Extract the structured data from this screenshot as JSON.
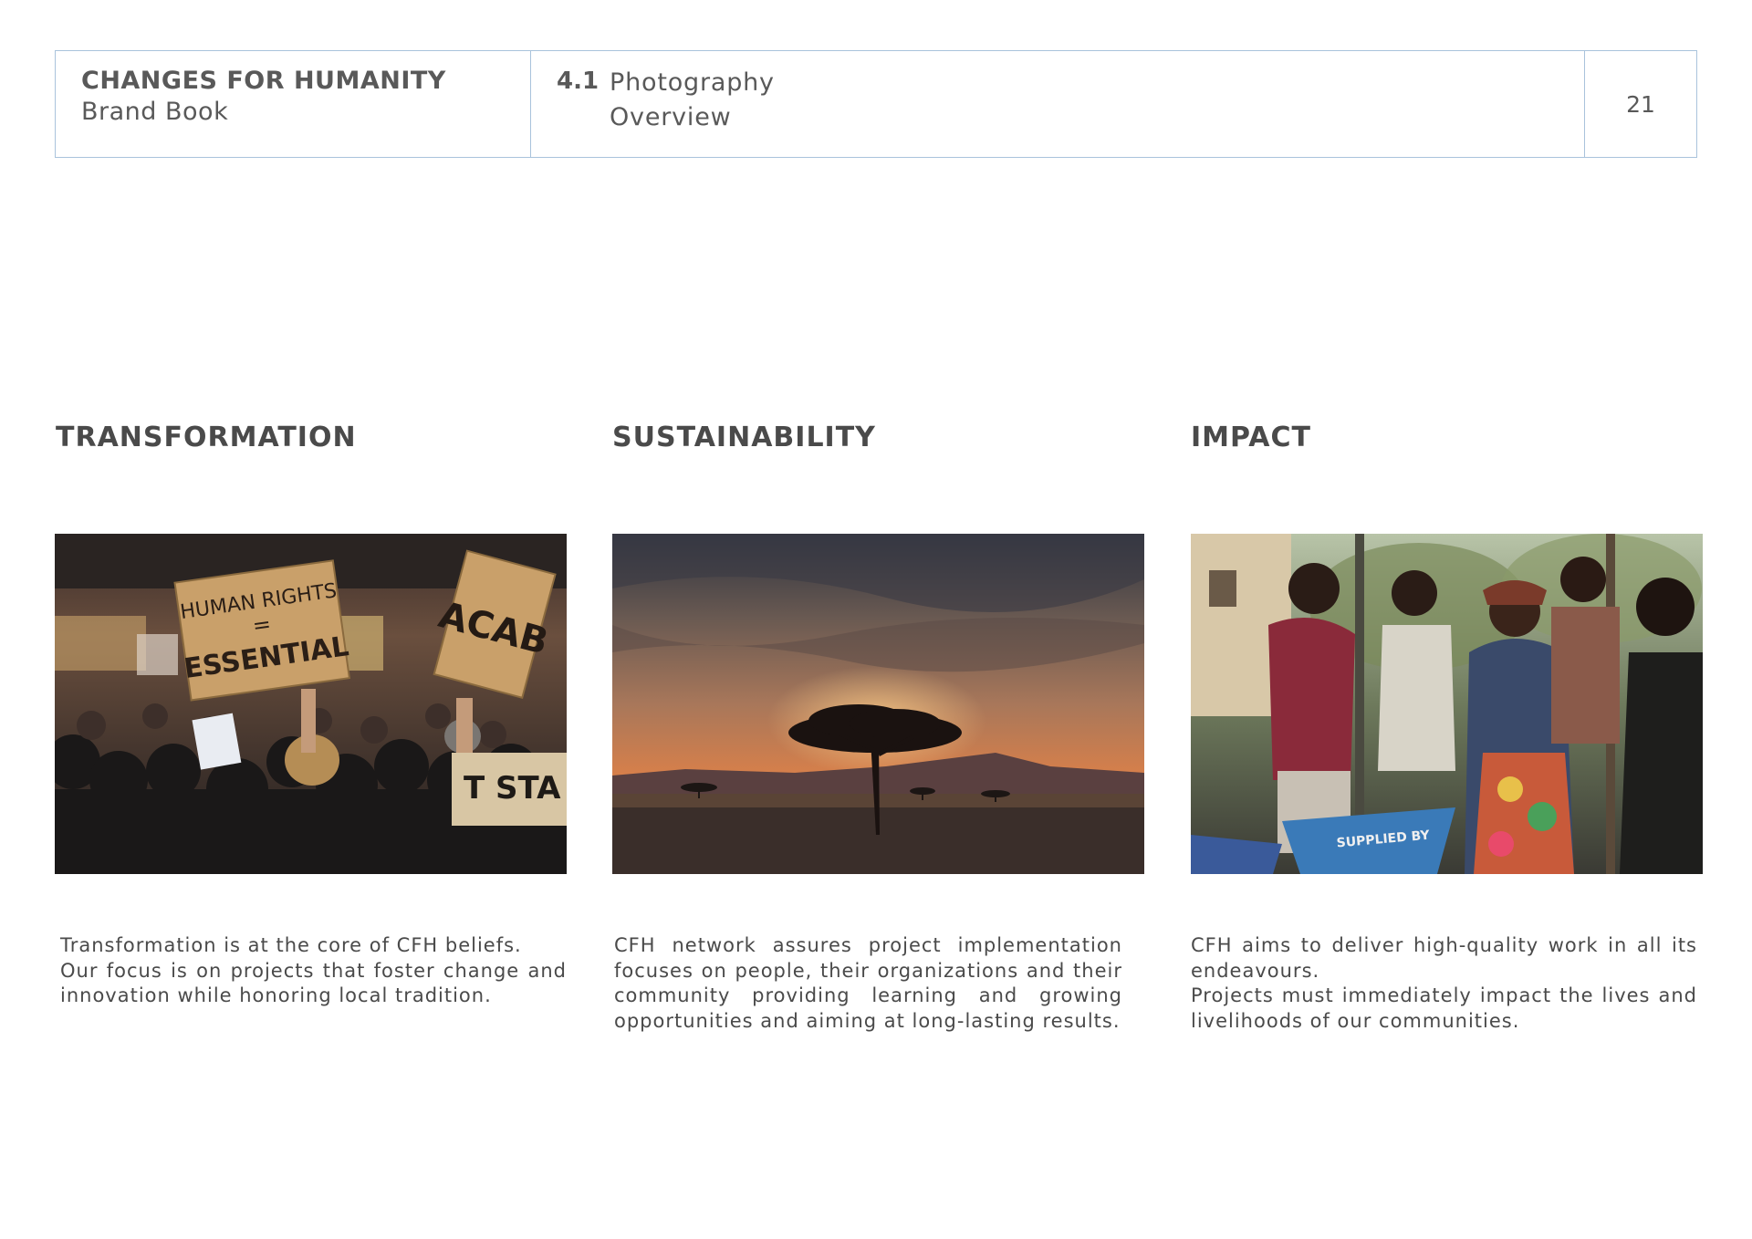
{
  "header": {
    "brand_title": "CHANGES FOR HUMANITY",
    "brand_subtitle": "Brand Book",
    "section_number": "4.1",
    "section_title": "Photography",
    "section_subtitle": "Overview",
    "page_number": "21"
  },
  "columns": [
    {
      "title": "TRANSFORMATION",
      "photo_icon": "protest-crowd-photo",
      "sign_1": [
        "HUMAN RIGHTS",
        "=",
        "ESSENTIAL"
      ],
      "sign_2": "ACAB",
      "sign_3": "T STA",
      "paragraphs": [
        "Transformation is at the core of CFH beliefs.",
        "Our focus is on projects that foster change and innovation while honoring local tradition."
      ]
    },
    {
      "title": "SUSTAINABILITY",
      "photo_icon": "savanna-sunset-tree-photo",
      "paragraphs": [
        "CFH network assures project implementation focuses on people, their organizations and their community providing learning and growing opportunities and aiming at long-lasting results."
      ]
    },
    {
      "title": "IMPACT",
      "photo_icon": "community-work-photo",
      "wheelbarrow_text": "SUPPLIED BY",
      "paragraphs": [
        "CFH aims to deliver high-quality work in all its endeavours.",
        "Projects must immediately impact the lives and livelihoods of our communities."
      ]
    }
  ],
  "colors": {
    "header_border": "#a9c3dc",
    "text": "#4a4a4a",
    "heading": "#595959"
  }
}
